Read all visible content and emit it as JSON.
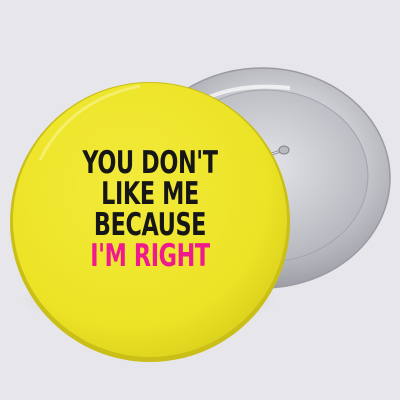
{
  "button_front": {
    "face_color": "#efe62a",
    "lines": [
      "YOU DON'T",
      "LIKE ME",
      "BECAUSE",
      "I'M RIGHT"
    ],
    "text_color": "#161616",
    "accent_color": "#f01a8f"
  },
  "button_back": {
    "color": "metallic-silver",
    "pin": "clasp-pin"
  },
  "background_color": "#e7e6eb"
}
